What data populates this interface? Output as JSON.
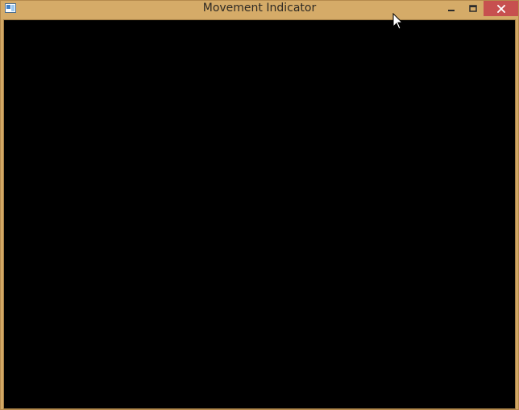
{
  "window": {
    "title": "Movement Indicator",
    "app_icon": "window-app-icon",
    "controls": {
      "minimize_icon": "minimize-icon",
      "maximize_icon": "maximize-icon",
      "close_icon": "close-icon"
    },
    "colors": {
      "frame": "#d2a865",
      "client_background": "#000000",
      "close_button": "#c7504f"
    }
  },
  "cursor": {
    "icon": "mouse-pointer-icon"
  }
}
